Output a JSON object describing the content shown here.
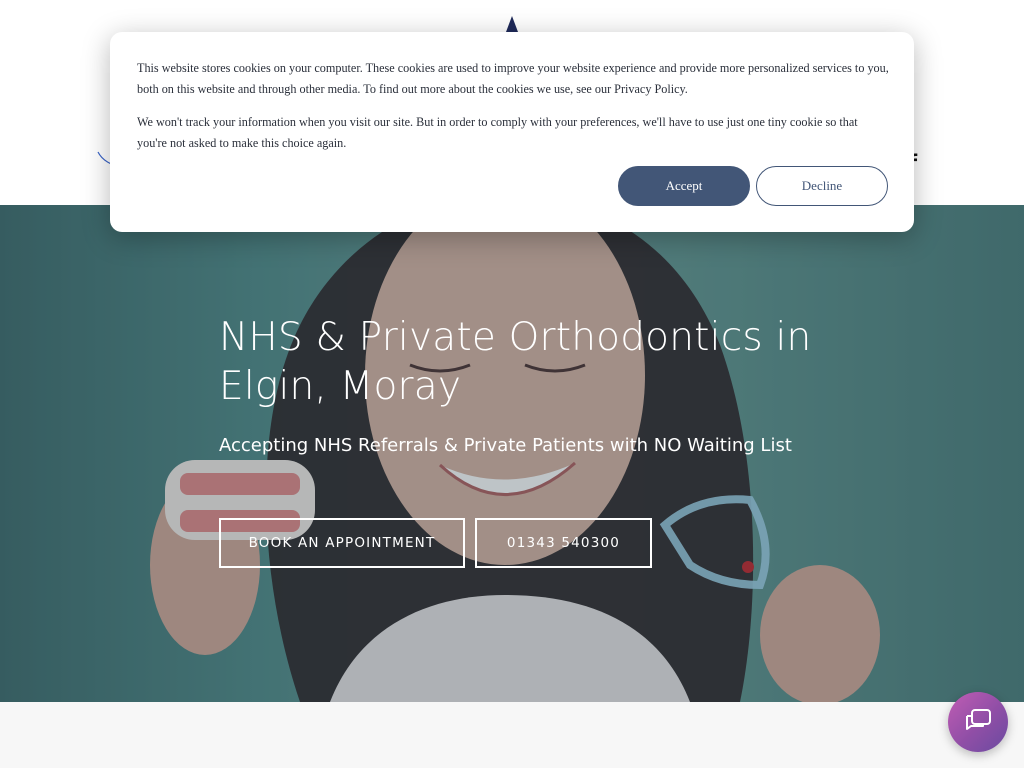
{
  "header": {
    "logo_icon": "logo-mark",
    "social_icon": "facebook-icon",
    "social_glyph": "f"
  },
  "hero": {
    "title": "NHS & Private Orthodontics in Elgin, Moray",
    "subtitle": "Accepting NHS Referrals & Private Patients with NO Waiting List",
    "book_button": "BOOK AN APPOINTMENT",
    "phone_button": "01343 540300"
  },
  "cookie_banner": {
    "text_1": "This website stores cookies on your computer. These cookies are used to improve your website experience and provide more personalized services to you, both on this website and through other media. To find out more about the cookies we use, see our Privacy Policy.",
    "text_2": "We won't track your information when you visit our site. But in order to comply with your preferences, we'll have to use just one tiny cookie so that you're not asked to make this choice again.",
    "accept_label": "Accept",
    "decline_label": "Decline"
  },
  "chat": {
    "icon": "chat-bubble-icon"
  },
  "colors": {
    "accent": "#425677",
    "hero_teal": "#5d928d",
    "chat_gradient_start": "#c15db4",
    "chat_gradient_end": "#6a4ba0"
  }
}
